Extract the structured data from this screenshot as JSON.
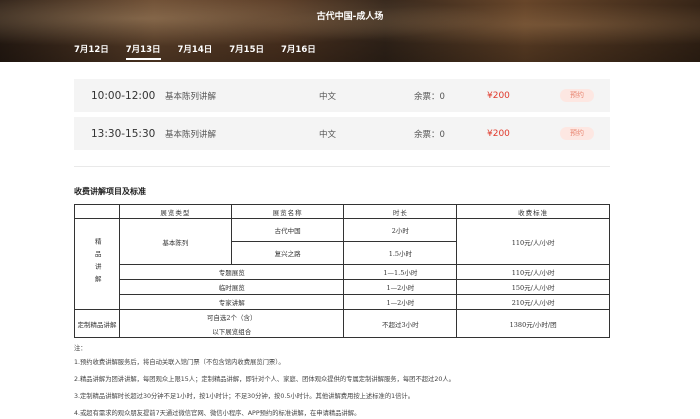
{
  "header": {
    "title": "古代中国-成人场",
    "dates": [
      "7月12日",
      "7月13日",
      "7月14日",
      "7月15日",
      "7月16日"
    ],
    "active_date": "7月13日"
  },
  "sessions": [
    {
      "time": "10:00-12:00",
      "name": "基本陈列讲解",
      "language": "中文",
      "remaining": "余票：0",
      "price": "¥200",
      "book_label": "预约"
    },
    {
      "time": "13:30-15:30",
      "name": "基本陈列讲解",
      "language": "中文",
      "remaining": "余票：0",
      "price": "¥200",
      "book_label": "预约"
    }
  ],
  "fees": {
    "title": "收费讲解项目及标准",
    "headers": [
      "展览类型",
      "展览名称",
      "时长",
      "收费标准"
    ],
    "category_label": "精品讲解",
    "basic": {
      "type": "基本陈列",
      "rows": [
        {
          "name": "古代中国",
          "duration": "2小时"
        },
        {
          "name": "复兴之路",
          "duration": "1.5小时"
        }
      ],
      "fee": "110元/人/小时"
    },
    "rows": [
      {
        "type": "专题展览",
        "duration": "1—1.5小时",
        "fee": "110元/人/小时"
      },
      {
        "type": "临时展览",
        "duration": "1—2小时",
        "fee": "150元/人/小时"
      },
      {
        "type": "专家讲解",
        "duration": "1—2小时",
        "fee": "210元/人/小时"
      }
    ],
    "custom": {
      "label": "定制精品讲解",
      "name_line1": "可自选2个（含）",
      "name_line2": "以下展览组合",
      "duration": "不超过3小时",
      "fee": "1380元/小时/团"
    }
  },
  "notes": {
    "label": "注：",
    "items": [
      "1.预约收费讲解服务后，将自动关联入馆门票（不包含馆内收费展览门票）。",
      "2.精品讲解为团讲讲解，每团观众上限15人；定制精品讲解，即针对个人、家庭、团体观众提供的专属定制讲解服务，每团不超过20人。",
      "3.定制精品讲解时长超过30分钟不足1小时，按1小时计；不足30分钟，按0.5小时计。其他讲解费用按上述标准的1倍计。",
      "4.或超有需求的观众朋友提前7天通过微信官网、微信小程序、APP预约的标准讲解，在申请精品讲解。"
    ]
  }
}
